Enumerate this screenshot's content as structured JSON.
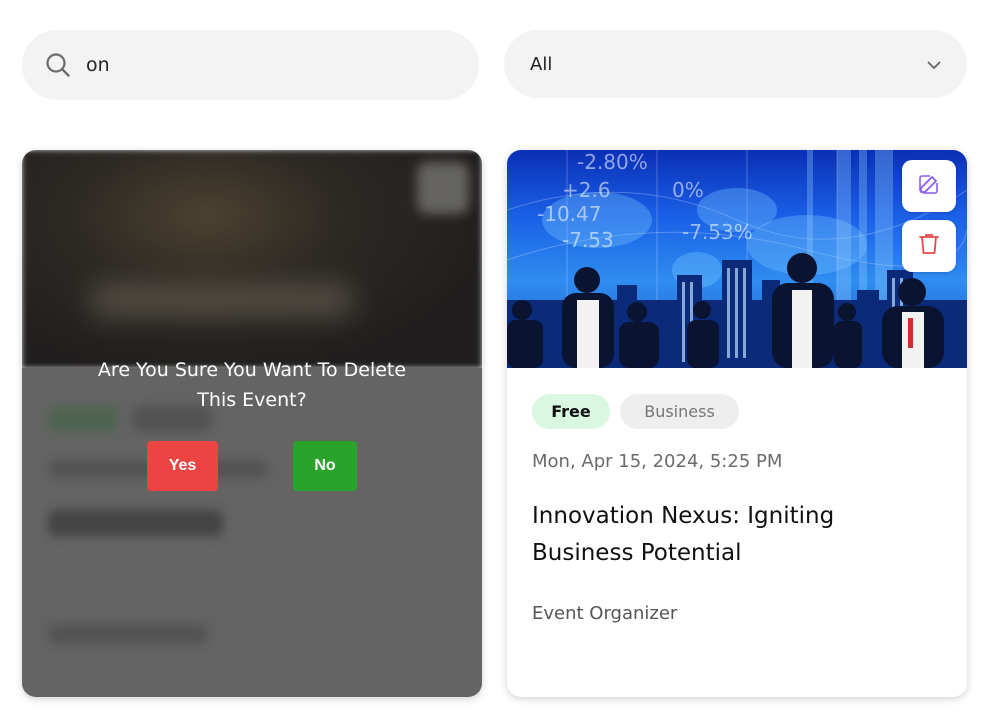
{
  "search": {
    "value": "on",
    "icon": "search-icon"
  },
  "filter": {
    "selected": "All",
    "icon": "chevron-down-icon"
  },
  "cards": [
    {
      "state": "delete-confirmation",
      "confirm_text": "Are You Sure You Want To Delete This Event?",
      "yes_label": "Yes",
      "no_label": "No",
      "colors": {
        "yes": "#ec4343",
        "no": "#2aa32a"
      }
    },
    {
      "price_tag": "Free",
      "category": "Business",
      "date": "Mon, Apr 15, 2024, 5:25 PM",
      "title": "Innovation Nexus: Igniting Business Potential",
      "organizer": "Event Organizer",
      "actions": {
        "edit_icon": "edit-icon",
        "delete_icon": "trash-icon"
      },
      "colors": {
        "free_tag_bg": "#d9f7e1",
        "category_tag_bg": "#eeeeee",
        "edit_icon": "#8a5cf0",
        "delete_icon": "#e24a4a"
      }
    }
  ]
}
